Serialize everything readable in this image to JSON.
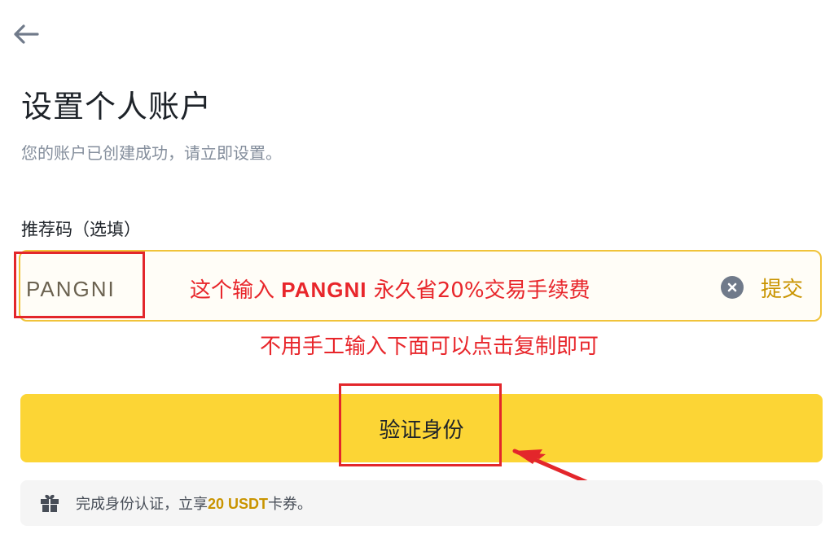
{
  "header": {
    "back_icon": "arrow-left-icon"
  },
  "page": {
    "title": "设置个人账户",
    "subtitle": "您的账户已创建成功，请立即设置。"
  },
  "referral": {
    "label": "推荐码（选填）",
    "value": "PANGNI",
    "clear_icon": "close-circle-icon",
    "submit_label": "提交"
  },
  "annotations": {
    "input_note_prefix": "这个输入 ",
    "input_note_code": "PANGNI",
    "input_note_suffix": " 永久省20%交易手续费",
    "copy_note": "不用手工输入下面可以点击复制即可",
    "highlight_color": "#e3262b"
  },
  "verify_button": {
    "label": "验证身份"
  },
  "promo": {
    "icon": "gift-icon",
    "text_prefix": "完成身份认证，立享",
    "highlight": "20 USDT",
    "text_suffix": "卡券。"
  },
  "colors": {
    "brand_yellow": "#fcd535",
    "accent_gold": "#c99400",
    "input_border": "#f0c33a",
    "annotation_red": "#e8262b"
  }
}
